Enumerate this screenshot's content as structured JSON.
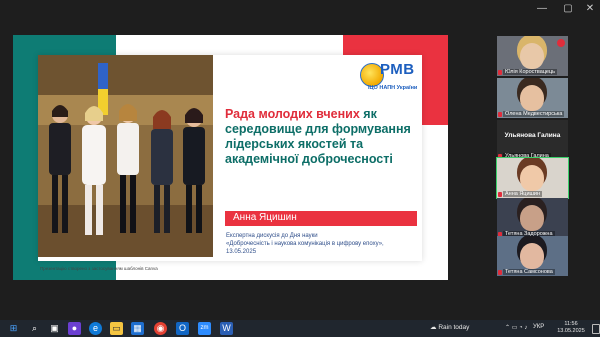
{
  "window": {
    "controls": [
      "—",
      "▢",
      "✕"
    ]
  },
  "slide": {
    "logo_text": "РМВ",
    "logo_sub": "ІЦО НАПН України",
    "title_highlight": "Рада молодих вчених",
    "title_rest": " як середовище для формування лідерських якостей та академічної доброчесності",
    "author": "Анна Яцишин",
    "event_line1": "Експертна дискусія до Дня науки",
    "event_line2": "«Доброчесність і наукова комунікація в цифрову епоху»,",
    "event_date": "13.05.2025",
    "footer_note": "Презентацію створено з застосуванням шаблонів Canva"
  },
  "participants": [
    {
      "name": "Юлія Короствацець",
      "type": "video",
      "bg": "#6b6f78",
      "skin": "#e8c8a8",
      "hair": "#d9b56a"
    },
    {
      "name": "Олена Медвестирська",
      "type": "video",
      "bg": "#7c8a96",
      "skin": "#e6c0a0",
      "hair": "#3a2a20"
    },
    {
      "name": "Ульянова Галина",
      "type": "name_only",
      "big_label": "Ульянова Галина"
    },
    {
      "name": "Анна Яцишин",
      "type": "video",
      "bg": "#d9d4cc",
      "skin": "#f0c9a8",
      "hair": "#6a3b24",
      "active": true
    },
    {
      "name": "Тетяна Задорожна",
      "type": "video",
      "bg": "#3b4150",
      "skin": "#c8a088",
      "hair": "#2a2020"
    },
    {
      "name": "Тетяна Самсонова",
      "type": "video",
      "bg": "#5d6f86",
      "skin": "#e2b8a0",
      "hair": "#1c1a20"
    }
  ],
  "taskbar": {
    "weather": "Rain today",
    "language": "УКР",
    "time": "11:56",
    "date": "13.05.2025"
  }
}
